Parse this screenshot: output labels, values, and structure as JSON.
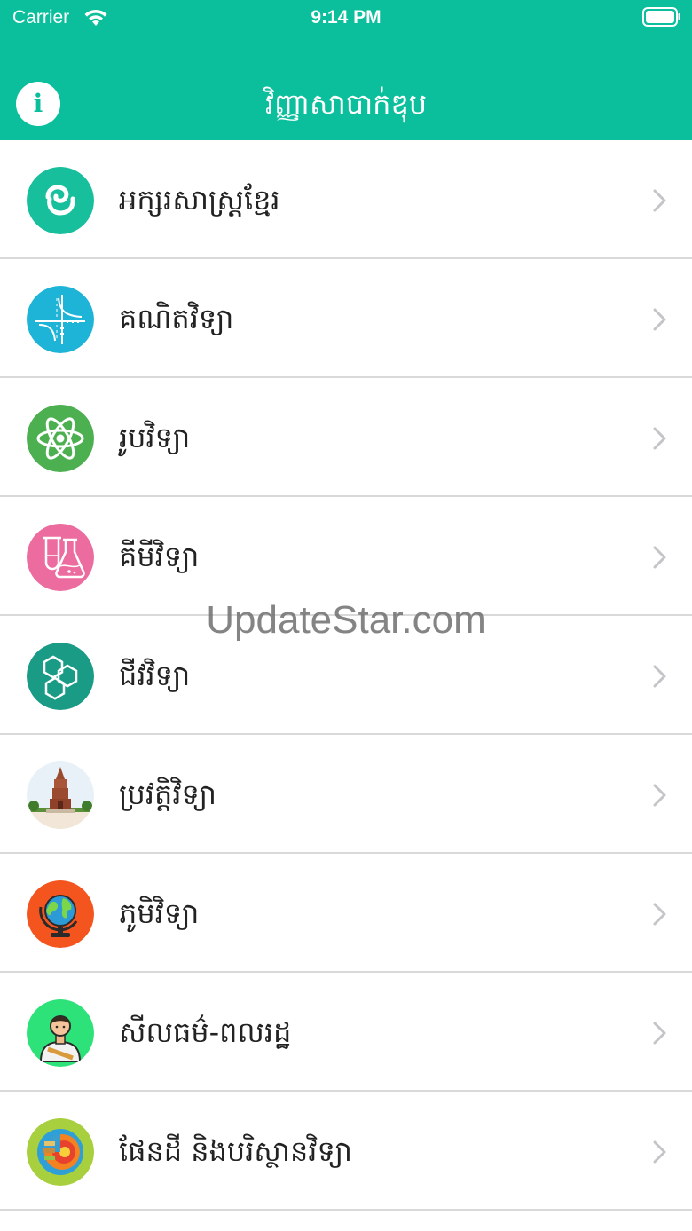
{
  "status_bar": {
    "carrier": "Carrier",
    "time": "9:14 PM"
  },
  "nav": {
    "title": "វិញ្ញាសាបាក់ឌុប",
    "info_glyph": "i"
  },
  "subjects": [
    {
      "label": "អក្សរសាស្ត្រខ្មែរ",
      "icon": "khmer-letter-icon",
      "badge_color": "#17bf9d",
      "glyph": "ខ"
    },
    {
      "label": "គណិតវិទ្យា",
      "icon": "math-graph-icon",
      "badge_color": "#1db4d8"
    },
    {
      "label": "រូបវិទ្យា",
      "icon": "atom-icon",
      "badge_color": "#4caf50"
    },
    {
      "label": "គីមីវិទ្យា",
      "icon": "flask-icon",
      "badge_color": "#ec6c9f"
    },
    {
      "label": "ជីវវិទ្យា",
      "icon": "molecule-icon",
      "badge_color": "#1a9b86"
    },
    {
      "label": "ប្រវត្តិវិទ្យា",
      "icon": "monument-icon",
      "badge_color": "#e7f1f7"
    },
    {
      "label": "ភូមិវិទ្យា",
      "icon": "globe-icon",
      "badge_color": "#f4551f"
    },
    {
      "label": "សីលធម៌-ពលរដ្ឋ",
      "icon": "citizen-icon",
      "badge_color": "#2ee27a"
    },
    {
      "label": "ផែនដី និងបរិស្ថានវិទ្យា",
      "icon": "earth-layers-icon",
      "badge_color": "#a8cf3d"
    }
  ],
  "watermark": "UpdateStar.com",
  "colors": {
    "primary": "#0bbf9c",
    "divider": "#d9d9d9",
    "chevron": "#c4c4c9"
  }
}
